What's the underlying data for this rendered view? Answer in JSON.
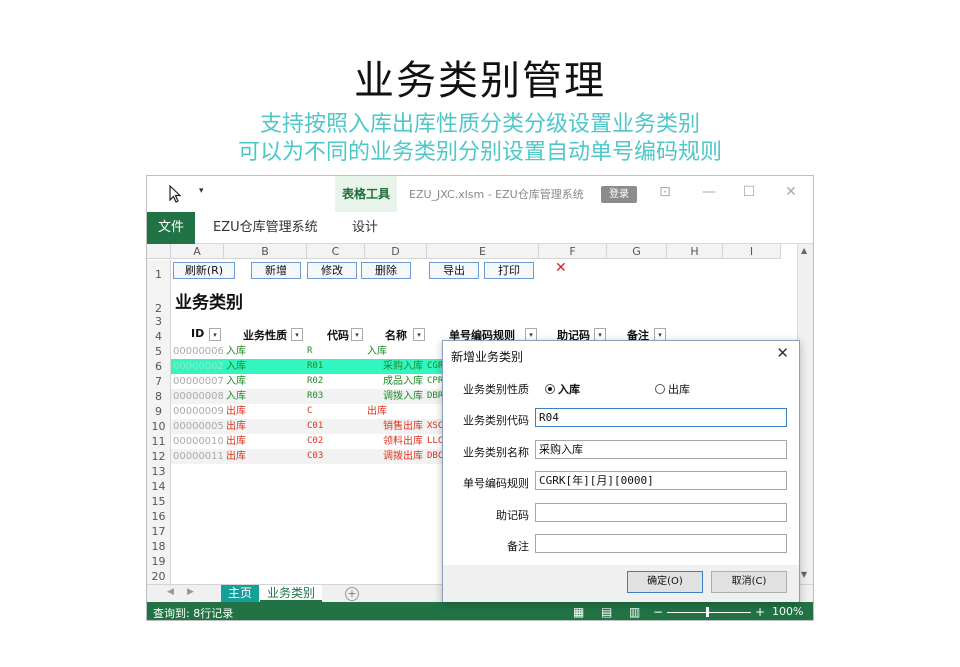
{
  "hero": {
    "title": "业务类别管理",
    "subtitle1": "支持按照入库出库性质分类分级设置业务类别",
    "subtitle2": "可以为不同的业务类别分别设置自动单号编码规则"
  },
  "titlebar": {
    "quick_access": "▾",
    "tools_tab": "表格工具",
    "doc_title": "EZU_JXC.xlsm - EZU仓库管理系统",
    "login": "登录",
    "restore_icon": "⊡",
    "minimize_icon": "—",
    "maximize_icon": "☐",
    "close_icon": "✕"
  },
  "ribbon": {
    "file": "文件",
    "tab_system": "EZU仓库管理系统",
    "tab_design": "设计"
  },
  "columns": [
    "A",
    "B",
    "C",
    "D",
    "E",
    "F",
    "G",
    "H",
    "I"
  ],
  "rows": [
    "1",
    "2",
    "3",
    "4",
    "5",
    "6",
    "7",
    "8",
    "9",
    "10",
    "11",
    "12",
    "13",
    "14",
    "15",
    "16",
    "17",
    "18",
    "19",
    "20"
  ],
  "toolbar": {
    "refresh": "刷新(R)",
    "add": "新增",
    "edit": "修改",
    "delete": "删除",
    "export": "导出",
    "print": "打印",
    "close_mark": "✕"
  },
  "sheet": {
    "title": "业务类别",
    "headers": {
      "id": "ID",
      "nature": "业务性质",
      "code": "代码",
      "name": "名称",
      "rule": "单号编码规则",
      "mnemonic": "助记码",
      "note": "备注"
    },
    "dropdown_glyph": "▾",
    "data": [
      {
        "id": "00000006",
        "nature": "入库",
        "code": "R",
        "name": "入库",
        "rule": ""
      },
      {
        "id": "00000002",
        "nature": "入库",
        "code": "R01",
        "name": "采购入库",
        "rule": "CGR"
      },
      {
        "id": "00000007",
        "nature": "入库",
        "code": "R02",
        "name": "成品入库",
        "rule": "CPR"
      },
      {
        "id": "00000008",
        "nature": "入库",
        "code": "R03",
        "name": "调拨入库",
        "rule": "DBR"
      },
      {
        "id": "00000009",
        "nature": "出库",
        "code": "C",
        "name": "出库",
        "rule": ""
      },
      {
        "id": "00000005",
        "nature": "出库",
        "code": "C01",
        "name": "销售出库",
        "rule": "XSC"
      },
      {
        "id": "00000010",
        "nature": "出库",
        "code": "C02",
        "name": "领料出库",
        "rule": "LLC"
      },
      {
        "id": "00000011",
        "nature": "出库",
        "code": "C03",
        "name": "调拨出库",
        "rule": "DBC"
      }
    ]
  },
  "tabs": {
    "main": "主页",
    "biz": "业务类别",
    "add": "+",
    "nav_left": "◀",
    "nav_right": "▶"
  },
  "status": {
    "text": "查询到: 8行记录",
    "zoom": "100%",
    "minus": "−",
    "plus": "+"
  },
  "dialog": {
    "title": "新增业务类别",
    "close": "✕",
    "nature_label": "业务类别性质",
    "radio_in": "入库",
    "radio_out": "出库",
    "code_label": "业务类别代码",
    "code_value": "R04",
    "name_label": "业务类别名称",
    "name_value": "采购入库",
    "rule_label": "单号编码规则",
    "rule_value": "CGRK[年][月][0000]",
    "mnemonic_label": "助记码",
    "mnemonic_value": "",
    "note_label": "备注",
    "note_value": "",
    "ok": "确定(O)",
    "cancel": "取消(C)"
  },
  "colors": {
    "excel_green": "#217346",
    "subtitle_teal": "#4fc7c9",
    "selected_row": "#33f5c0",
    "in_green": "#1f8a2a",
    "out_red": "#e0321f"
  }
}
